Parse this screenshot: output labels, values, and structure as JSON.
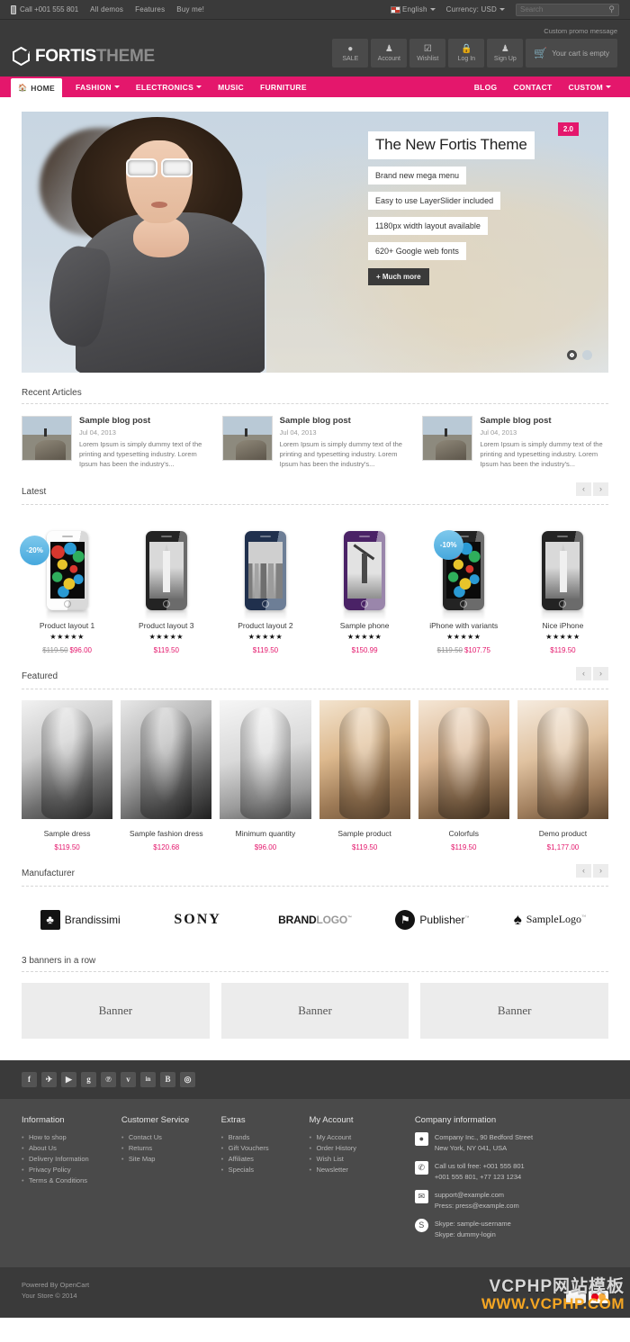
{
  "topbar": {
    "phone": "Call +001 555 801",
    "links": [
      "All demos",
      "Features",
      "Buy me!"
    ],
    "language": "English",
    "currency": "Currency: USD",
    "search_placeholder": "Search",
    "search_value": ""
  },
  "header": {
    "promo": "Custom promo message",
    "logo_a": "FORTIS",
    "logo_b": "THEME",
    "actions": [
      {
        "icon": "sale-icon",
        "glyph": "●",
        "label": "SALE"
      },
      {
        "icon": "account-icon",
        "glyph": "☰",
        "label": "Account"
      },
      {
        "icon": "wishlist-icon",
        "glyph": "☑",
        "label": "Wishlist"
      },
      {
        "icon": "lock-icon",
        "glyph": "■",
        "label": "Log In"
      },
      {
        "icon": "signup-icon",
        "glyph": "☰",
        "label": "Sign Up"
      }
    ],
    "cart_label": "Your cart is empty"
  },
  "nav": {
    "home": "HOME",
    "left": [
      "FASHION",
      "ELECTRONICS",
      "MUSIC",
      "FURNITURE"
    ],
    "left_caret": [
      true,
      true,
      false,
      false
    ],
    "right": [
      "BLOG",
      "CONTACT",
      "CUSTOM"
    ],
    "right_caret": [
      false,
      false,
      true
    ],
    "accent": "#e4176c"
  },
  "slider": {
    "badge": "2.0",
    "title": "The New Fortis Theme",
    "items": [
      "Brand new mega menu",
      "Easy to use LayerSlider included",
      "1180px width layout available",
      "620+ Google web fonts"
    ],
    "button": "+ Much more",
    "dots": 2,
    "active_dot": 0
  },
  "recent_articles": {
    "title": "Recent Articles",
    "posts": [
      {
        "title": "Sample blog post",
        "date": "Jul 04, 2013",
        "excerpt": "Lorem Ipsum is simply dummy text of the printing and typesetting industry. Lorem Ipsum has been the industry's..."
      },
      {
        "title": "Sample blog post",
        "date": "Jul 04, 2013",
        "excerpt": "Lorem Ipsum is simply dummy text of the printing and typesetting industry. Lorem Ipsum has been the industry's..."
      },
      {
        "title": "Sample blog post",
        "date": "Jul 04, 2013",
        "excerpt": "Lorem Ipsum is simply dummy text of the printing and typesetting industry. Lorem Ipsum has been the industry's..."
      }
    ]
  },
  "latest": {
    "title": "Latest",
    "prev": "‹",
    "next": "›",
    "products": [
      {
        "name": "Product layout 1",
        "stars": "★★★★★",
        "old_price": "$119.50",
        "price": "$96.00",
        "badge": "-20%",
        "style": "ph-white",
        "screen": "balloons"
      },
      {
        "name": "Product layout 3",
        "stars": "★★★★★",
        "old_price": "",
        "price": "$119.50",
        "badge": "",
        "style": "ph-black",
        "screen": "church"
      },
      {
        "name": "Product layout 2",
        "stars": "★★★★★",
        "old_price": "",
        "price": "$119.50",
        "badge": "",
        "style": "ph-blue",
        "screen": "city"
      },
      {
        "name": "Sample phone",
        "stars": "★★★★★",
        "old_price": "",
        "price": "$150.99",
        "badge": "",
        "style": "ph-purple",
        "screen": "mill"
      },
      {
        "name": "iPhone with variants",
        "stars": "★★★★★",
        "old_price": "$119.50",
        "price": "$107.75",
        "badge": "-10%",
        "style": "ph-black",
        "screen": "balloons"
      },
      {
        "name": "Nice iPhone",
        "stars": "★★★★★",
        "old_price": "",
        "price": "$119.50",
        "badge": "",
        "style": "ph-black",
        "screen": "church"
      }
    ]
  },
  "featured": {
    "title": "Featured",
    "prev": "‹",
    "next": "›",
    "products": [
      {
        "name": "Sample dress",
        "price": "$119.50",
        "style": "f1"
      },
      {
        "name": "Sample fashion dress",
        "price": "$120.68",
        "style": "f2"
      },
      {
        "name": "Minimum quantity",
        "price": "$96.00",
        "style": "f3"
      },
      {
        "name": "Sample product",
        "price": "$119.50",
        "style": "f4"
      },
      {
        "name": "Colorfuls",
        "price": "$119.50",
        "style": "f5"
      },
      {
        "name": "Demo product",
        "price": "$1,177.00",
        "style": "f6"
      }
    ]
  },
  "manufacturer": {
    "title": "Manufacturer",
    "prev": "‹",
    "next": "›",
    "logos": [
      {
        "icon": "club-icon",
        "glyph": "♣",
        "name": "Brandissimi",
        "tm": "™",
        "kind": "square"
      },
      {
        "icon": "sony-wordmark",
        "glyph": "",
        "name": "SONY",
        "tm": "",
        "kind": "serif"
      },
      {
        "icon": "brandlogo-wordmark",
        "glyph": "",
        "name": "BRAND",
        "name2": "LOGO",
        "tm": "™",
        "kind": "split"
      },
      {
        "icon": "flag-icon",
        "glyph": "⚑",
        "name": "Publisher",
        "tm": "™",
        "kind": "circle"
      },
      {
        "icon": "spade-icon",
        "glyph": "♠",
        "name": "SampleLogo",
        "tm": "™",
        "kind": "spade"
      }
    ]
  },
  "banners": {
    "title": "3 banners in a row",
    "items": [
      "Banner",
      "Banner",
      "Banner"
    ]
  },
  "footer": {
    "social": [
      {
        "name": "facebook-icon",
        "glyph": "f"
      },
      {
        "name": "twitter-icon",
        "glyph": "✈"
      },
      {
        "name": "youtube-icon",
        "glyph": "▶"
      },
      {
        "name": "googleplus-icon",
        "glyph": "g"
      },
      {
        "name": "pinterest-icon",
        "glyph": "℗"
      },
      {
        "name": "vimeo-icon",
        "glyph": "v"
      },
      {
        "name": "linkedin-icon",
        "glyph": "in"
      },
      {
        "name": "blogger-icon",
        "glyph": "B"
      },
      {
        "name": "instagram-icon",
        "glyph": "◎"
      }
    ],
    "columns": [
      {
        "title": "Information",
        "items": [
          "How to shop",
          "About Us",
          "Delivery Information",
          "Privacy Policy",
          "Terms & Conditions"
        ]
      },
      {
        "title": "Customer Service",
        "items": [
          "Contact Us",
          "Returns",
          "Site Map"
        ]
      },
      {
        "title": "Extras",
        "items": [
          "Brands",
          "Gift Vouchers",
          "Affiliates",
          "Specials"
        ]
      },
      {
        "title": "My Account",
        "items": [
          "My Account",
          "Order History",
          "Wish List",
          "Newsletter"
        ]
      }
    ],
    "company": {
      "title": "Company information",
      "rows": [
        {
          "icon": "location-pin-icon",
          "glyph": "◆",
          "line1": "Company Inc., 90 Bedford Street",
          "line2": "New York, NY 041, USA"
        },
        {
          "icon": "phone-icon",
          "glyph": "✆",
          "line1": "Call us toll free: +001 555 801",
          "line2": "+001 555 801, +77 123 1234"
        },
        {
          "icon": "mail-icon",
          "glyph": "✉",
          "line1": "support@example.com",
          "line2": "Press: press@example.com"
        },
        {
          "icon": "skype-icon",
          "glyph": "S",
          "line1": "Skype: sample-username",
          "line2": "Skype: dummy-login"
        }
      ]
    },
    "bottom": {
      "powered": "Powered By OpenCart",
      "copyright": "Your Store © 2014"
    }
  },
  "watermark": {
    "line1": "VCPHP网站模板",
    "line2": "WWW.VCPHP.COM"
  }
}
